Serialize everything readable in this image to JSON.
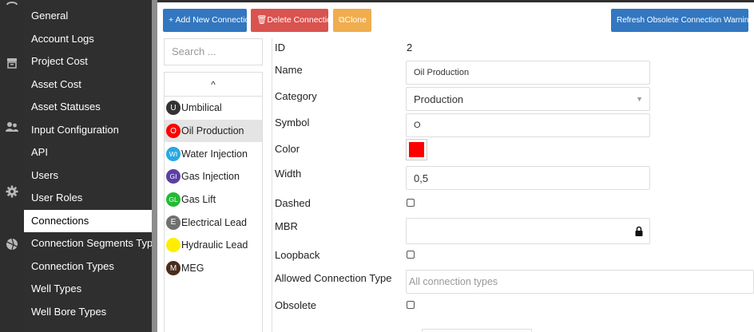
{
  "nav": {
    "items": [
      {
        "label": "General"
      },
      {
        "label": "Account Logs"
      },
      {
        "label": "Project Cost"
      },
      {
        "label": "Asset Cost"
      },
      {
        "label": "Asset Statuses"
      },
      {
        "label": "Input Configuration"
      },
      {
        "label": "API"
      },
      {
        "label": "Users"
      },
      {
        "label": "User Roles"
      },
      {
        "label": "Connections"
      },
      {
        "label": "Connection Segments Typ..."
      },
      {
        "label": "Connection Types"
      },
      {
        "label": "Well Types"
      },
      {
        "label": "Well Bore Types"
      }
    ]
  },
  "toolbar": {
    "add_label": "+ Add New Connection",
    "delete_label": "🗑Delete Connection",
    "clone_label": "⧉Clone",
    "refresh_label": "Refresh Obsolete Connection Warnings"
  },
  "list": {
    "search_placeholder": "Search ...",
    "scroll_up": "^",
    "items": [
      {
        "symbol": "U",
        "name": "Umbilical",
        "color": "#333333"
      },
      {
        "symbol": "O",
        "name": "Oil Production",
        "color": "#ff0000"
      },
      {
        "symbol": "WI",
        "name": "Water Injection",
        "color": "#29a8e0"
      },
      {
        "symbol": "GI",
        "name": "Gas Injection",
        "color": "#5b3fa6"
      },
      {
        "symbol": "GL",
        "name": "Gas Lift",
        "color": "#22bb33"
      },
      {
        "symbol": "E",
        "name": "Electrical Lead",
        "color": "#707070"
      },
      {
        "symbol": "H",
        "name": "Hydraulic Lead",
        "color": "#ffee00"
      },
      {
        "symbol": "M",
        "name": "MEG",
        "color": "#4a2c1c"
      }
    ]
  },
  "form": {
    "id_label": "ID",
    "id_value": "2",
    "name_label": "Name",
    "name_value": "Oil Production",
    "category_label": "Category",
    "category_value": "Production",
    "symbol_label": "Symbol",
    "symbol_value": "O",
    "color_label": "Color",
    "color_value": "#ff0000",
    "width_label": "Width",
    "width_value": "0,5",
    "dashed_label": "Dashed",
    "mbr_label": "MBR",
    "loopback_label": "Loopback",
    "allowed_label": "Allowed Connection Type",
    "allowed_placeholder": "All connection types",
    "obsolete_label": "Obsolete"
  }
}
